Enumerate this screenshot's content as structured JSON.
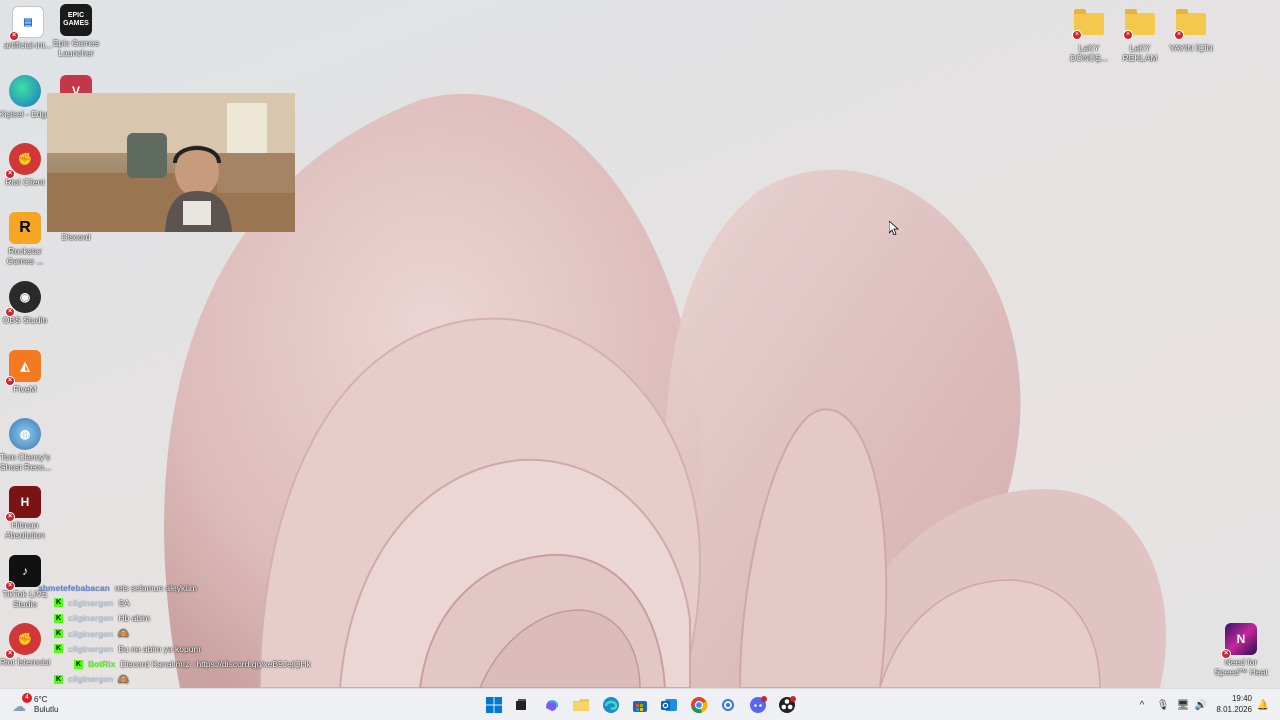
{
  "desktop_icons_left": [
    {
      "name": "ai-pdf-icon",
      "label": "artificial-int...",
      "color": "#2b6cd4"
    },
    {
      "name": "epic-games-icon",
      "label": "Epic Games Launcher",
      "color": "#1a1a1a",
      "glyph": "EPIC GAMES"
    },
    {
      "name": "edge-icon",
      "label": "Kişisel - Edge",
      "color": "#2d8fd5"
    },
    {
      "name": "riot-client-icon",
      "label": "Riot Client",
      "color": "#d13639"
    },
    {
      "name": "rockstar-icon",
      "label": "Rockstar Games ...",
      "color": "#f5a623",
      "glyph": "R"
    },
    {
      "name": "discord-desktop-icon",
      "label": "Discord",
      "color": "#5865f2"
    },
    {
      "name": "obs-icon",
      "label": "OBS Studio",
      "color": "#2a2a2a"
    },
    {
      "name": "fivem-icon",
      "label": "FiveM",
      "color": "#f47a21"
    },
    {
      "name": "ghost-recon-icon",
      "label": "Tom Clancy's Ghost Reco...",
      "color": "#4a86b5"
    },
    {
      "name": "hitman-icon",
      "label": "Hitman Absolution",
      "color": "#8a1a1a"
    },
    {
      "name": "tiktok-icon",
      "label": "TikTok LIVE Studio",
      "color": "#111111"
    },
    {
      "name": "riot-client-2-icon",
      "label": "Riot İstemcisi",
      "color": "#d13639"
    },
    {
      "name": "valorant-icon",
      "label": "",
      "color": "#c43649"
    }
  ],
  "desktop_icons_right": [
    {
      "name": "folder-icon",
      "label": "LaKY DÖNÜŞ..."
    },
    {
      "name": "folder-icon",
      "label": "LaKY REKLAM"
    },
    {
      "name": "folder-icon",
      "label": "YAYIN İÇİN"
    }
  ],
  "nfs_icon": {
    "label": "Need for Speed™ Heat"
  },
  "chat": [
    {
      "user": "ahmetefebabacan",
      "msg": "reis selamun aleyküm",
      "badge": false
    },
    {
      "user": "cilginergen",
      "msg": "SA",
      "badge": true
    },
    {
      "user": "cilginergen",
      "msg": "Hb abim",
      "badge": true
    },
    {
      "user": "cilginergen",
      "msg": "🙈",
      "badge": true
    },
    {
      "user": "",
      "msg": "Bu ne abim ya kopum",
      "badge": false
    },
    {
      "user": "BotRix",
      "msg": "Discord Kanalımız : https://discord.gg/xeB9JejQHk",
      "badge": true,
      "indent": true
    },
    {
      "user": "cilginergen",
      "msg": "🙈",
      "badge": true
    }
  ],
  "taskbar": {
    "weather_temp": "6°C",
    "weather_desc": "Bulutlu",
    "weather_badge": "4",
    "time": "19:40",
    "date": "8.01.2026"
  },
  "colors": {
    "accent": "#0067c0",
    "petal": "#e8cfcf",
    "background": "#e2e3e5"
  }
}
